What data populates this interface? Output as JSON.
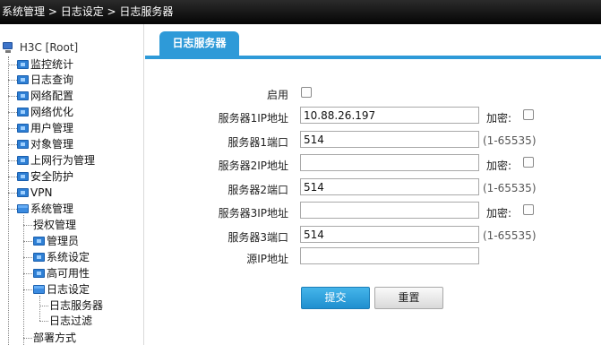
{
  "breadcrumb": {
    "level1": "系统管理",
    "sep1": " > ",
    "level2": "日志设定",
    "sep2": " > ",
    "level3": "日志服务器"
  },
  "sidebar": {
    "root": "H3C [Root]",
    "items": [
      {
        "label": "监控统计"
      },
      {
        "label": "日志查询"
      },
      {
        "label": "网络配置"
      },
      {
        "label": "网络优化"
      },
      {
        "label": "用户管理"
      },
      {
        "label": "对象管理"
      },
      {
        "label": "上网行为管理"
      },
      {
        "label": "安全防护"
      },
      {
        "label": "VPN"
      },
      {
        "label": "系统管理"
      }
    ],
    "sub": [
      {
        "label": "授权管理"
      },
      {
        "label": "管理员"
      },
      {
        "label": "系统设定"
      },
      {
        "label": "高可用性"
      },
      {
        "label": "日志设定"
      }
    ],
    "subsub": [
      {
        "label": "日志服务器"
      },
      {
        "label": "日志过滤"
      }
    ],
    "last": "部署方式"
  },
  "tab": {
    "label": "日志服务器"
  },
  "form": {
    "enable_label": "启用",
    "server1_ip_label": "服务器1IP地址",
    "server1_ip_value": "10.88.26.197",
    "server1_port_label": "服务器1端口",
    "server1_port_value": "514",
    "server2_ip_label": "服务器2IP地址",
    "server2_ip_value": "",
    "server2_port_label": "服务器2端口",
    "server2_port_value": "514",
    "server3_ip_label": "服务器3IP地址",
    "server3_ip_value": "",
    "server3_port_label": "服务器3端口",
    "server3_port_value": "514",
    "source_ip_label": "源IP地址",
    "source_ip_value": "",
    "encrypt_label": "加密:",
    "port_range": "(1-65535)"
  },
  "buttons": {
    "submit": "提交",
    "reset": "重置"
  },
  "colors": {
    "accent": "#2e9ad8",
    "topbar": "#111111"
  }
}
